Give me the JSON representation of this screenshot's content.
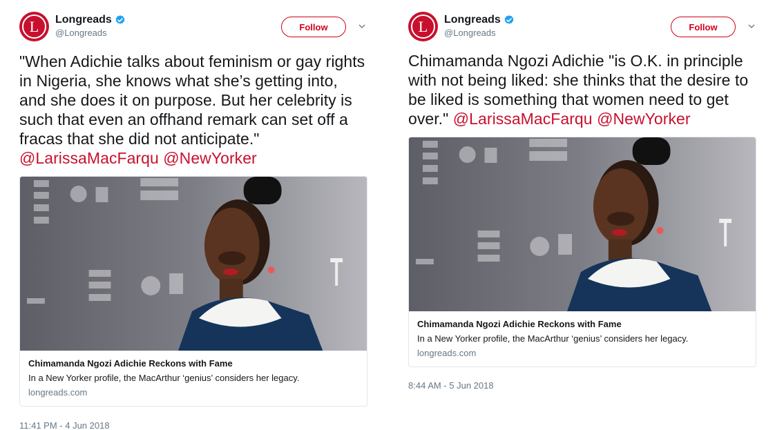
{
  "brand": {
    "accent": "#c8102e",
    "verified": "#1da1f2",
    "muted": "#657786"
  },
  "tweets": [
    {
      "author": {
        "name": "Longreads",
        "handle": "@Longreads",
        "avatar_letter": "L"
      },
      "follow_label": "Follow",
      "text": "\"When Adichie talks about feminism or gay rights in Nigeria, she knows what she’s getting into, and she does it on purpose. But her celebrity is such that even an offhand remark can set off a fracas that she did not anticipate.\" ",
      "mentions": [
        "@LarissaMacFarqu",
        "@NewYorker"
      ],
      "card": {
        "title": "Chimamanda Ngozi Adichie Reckons with Fame",
        "description": "In a New Yorker profile, the MacArthur ‘genius’ considers her legacy.",
        "domain": "longreads.com"
      },
      "timestamp": "11:41 PM - 4 Jun 2018"
    },
    {
      "author": {
        "name": "Longreads",
        "handle": "@Longreads",
        "avatar_letter": "L"
      },
      "follow_label": "Follow",
      "text": "Chimamanda Ngozi Adichie \"is O.K. in principle with not being liked: she thinks that the desire to be liked is something that women need to get over.\" ",
      "mentions": [
        "@LarissaMacFarqu",
        "@NewYorker"
      ],
      "card": {
        "title": "Chimamanda Ngozi Adichie Reckons with Fame",
        "description": "In a New Yorker profile, the MacArthur ‘genius’ considers her legacy.",
        "domain": "longreads.com"
      },
      "timestamp": "8:44 AM - 5 Jun 2018"
    }
  ]
}
